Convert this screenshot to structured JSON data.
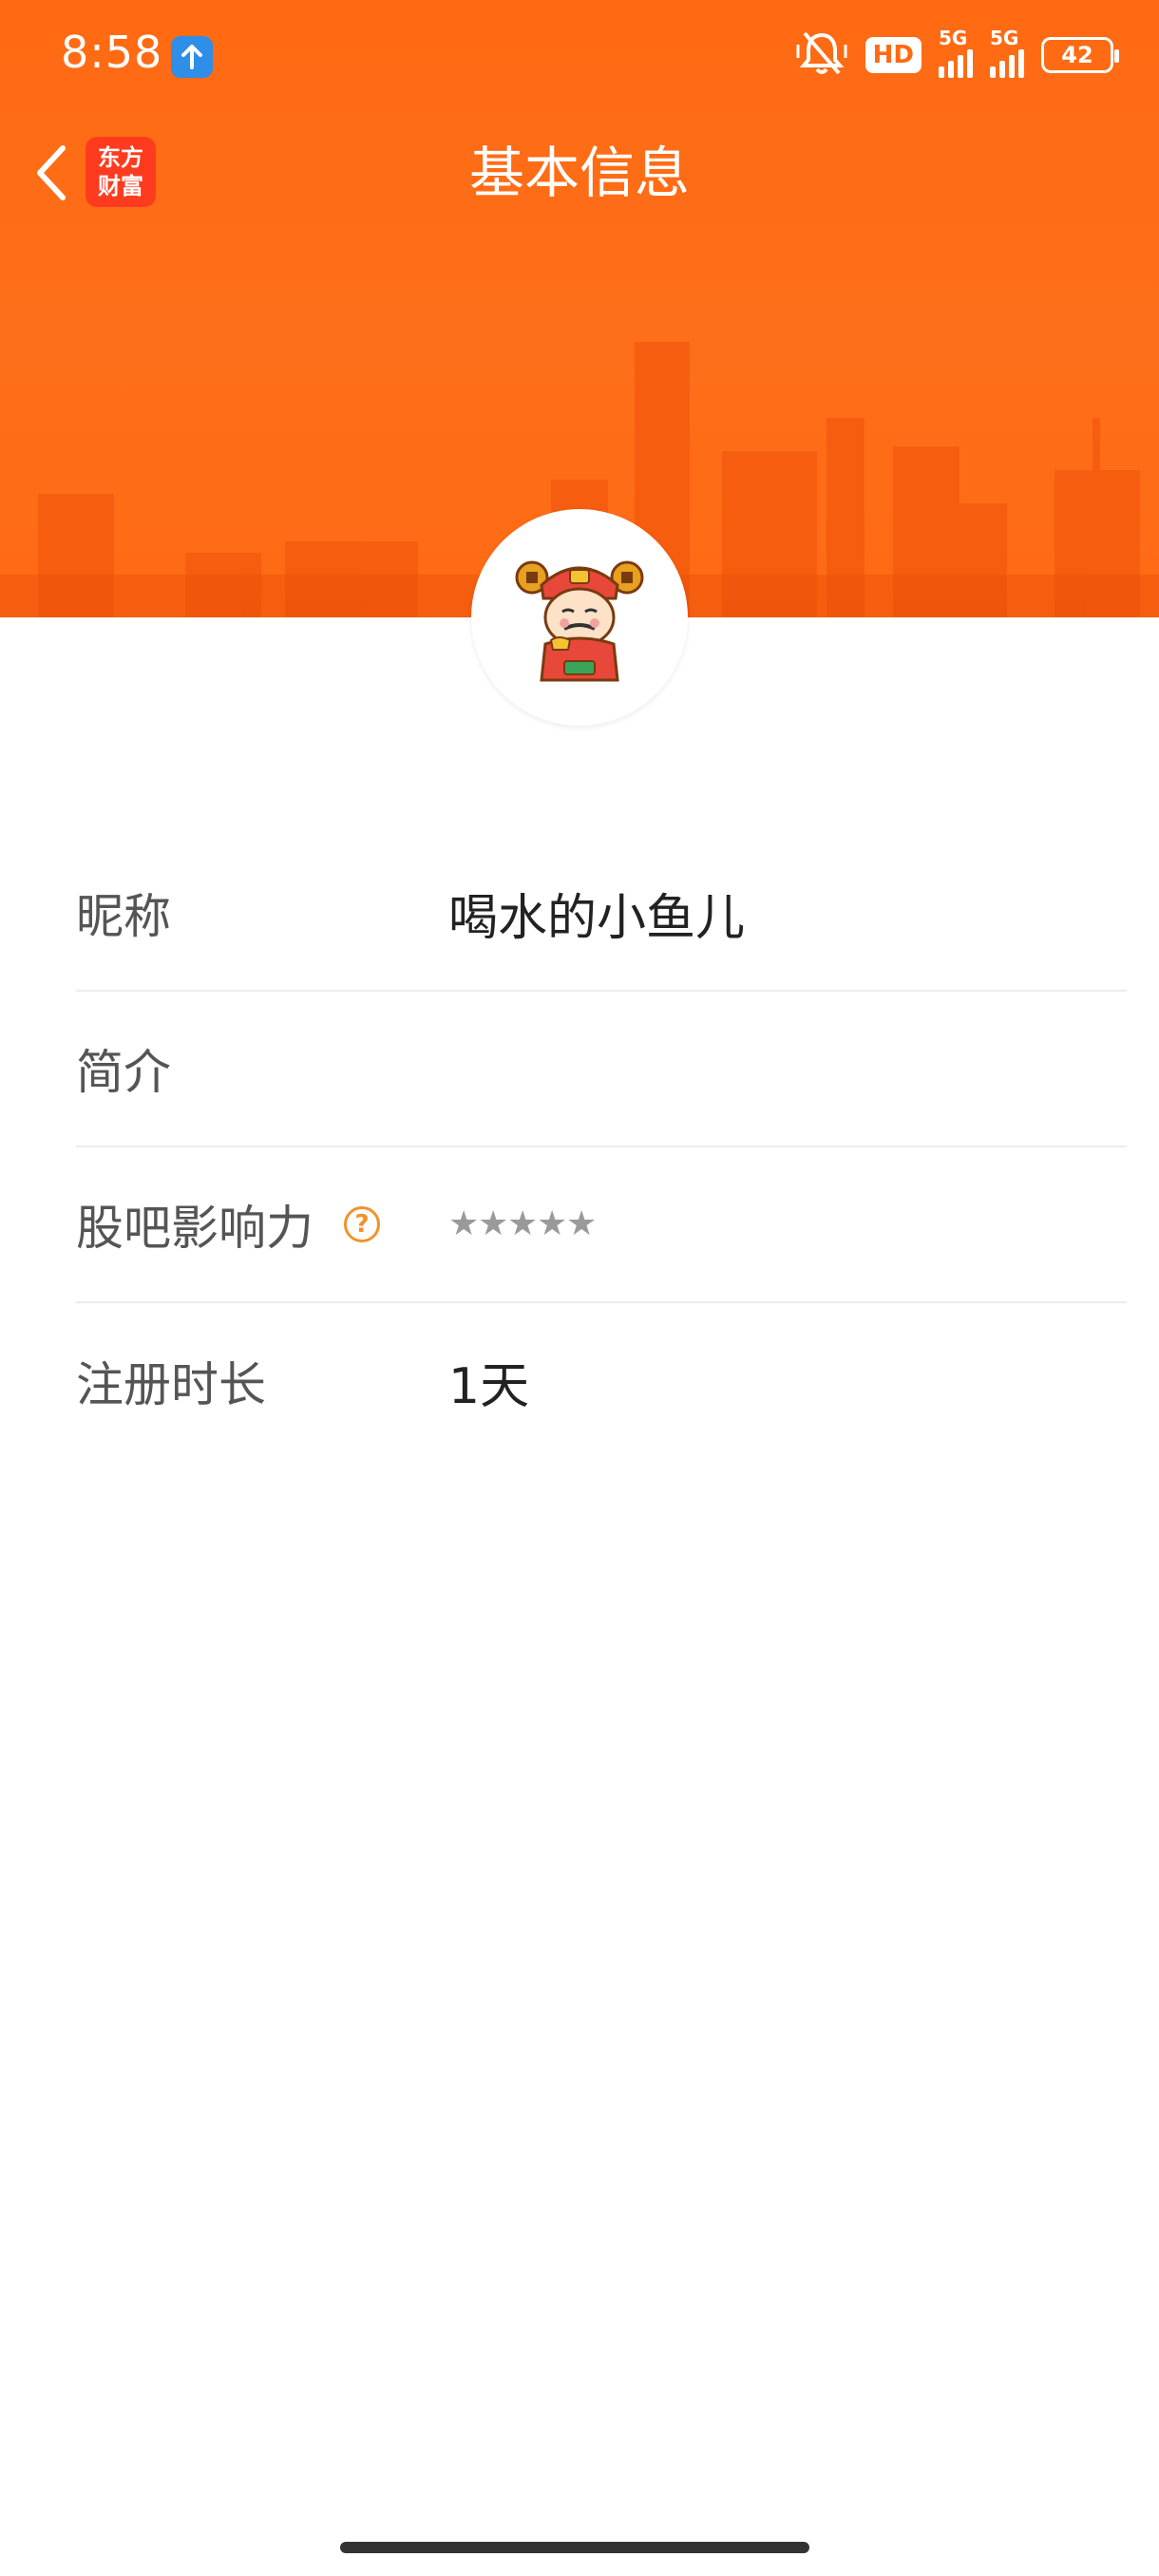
{
  "status_bar": {
    "time": "8:58",
    "network_1": "5G",
    "network_2": "5G",
    "hd_label": "HD",
    "battery": "42"
  },
  "nav": {
    "title": "基本信息",
    "logo_line1": "东方",
    "logo_line2": "财富"
  },
  "colors": {
    "header_orange": "#ff6a12",
    "help_icon_orange": "#f2922a"
  },
  "profile": {
    "avatar_icon": "god-of-wealth-avatar-icon",
    "nickname_label": "昵称",
    "nickname_value": "喝水的小鱼儿",
    "intro_label": "简介",
    "intro_value": "",
    "influence_label": "股吧影响力",
    "influence_help": "?",
    "influence_stars_total": 5,
    "influence_stars_filled": 0,
    "register_label": "注册时长",
    "register_value": "1天"
  }
}
